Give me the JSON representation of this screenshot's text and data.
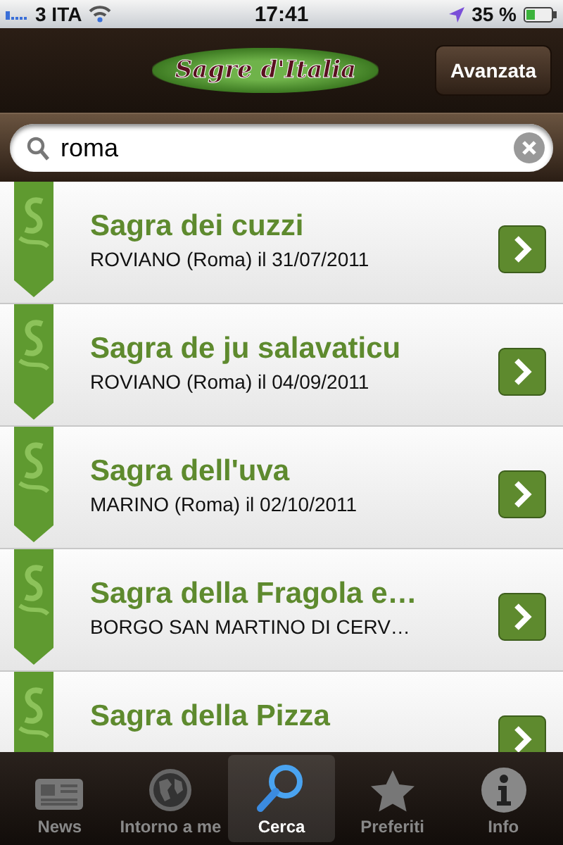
{
  "status_bar": {
    "carrier": "3 ITA",
    "time": "17:41",
    "battery": "35 %"
  },
  "nav_bar": {
    "logo": "Sagre d'Italia",
    "button": "Avanzata"
  },
  "search": {
    "value": "roma"
  },
  "results": [
    {
      "title": "Sagra dei cuzzi",
      "subtitle": "ROVIANO (Roma) il 31/07/2011"
    },
    {
      "title": "Sagra de ju salavaticu",
      "subtitle": "ROVIANO (Roma) il 04/09/2011"
    },
    {
      "title": "Sagra dell'uva",
      "subtitle": "MARINO (Roma) il 02/10/2011"
    },
    {
      "title": "Sagra della Fragola e…",
      "subtitle": "BORGO SAN MARTINO DI CERV…"
    },
    {
      "title": "Sagra della Pizza"
    }
  ],
  "tabs": [
    {
      "label": "News",
      "kind": "news",
      "selected": false
    },
    {
      "label": "Intorno a me",
      "kind": "globe",
      "selected": false
    },
    {
      "label": "Cerca",
      "kind": "search",
      "selected": true
    },
    {
      "label": "Preferiti",
      "kind": "star",
      "selected": false
    },
    {
      "label": "Info",
      "kind": "info",
      "selected": false
    }
  ]
}
